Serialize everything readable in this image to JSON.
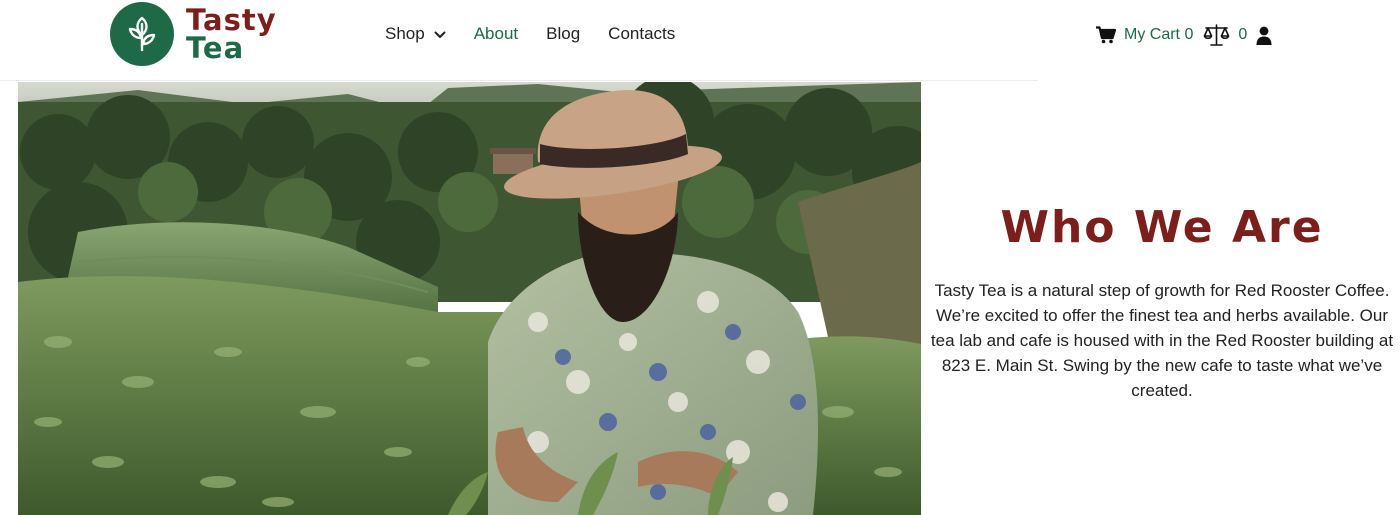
{
  "brand": {
    "line1": "Tasty",
    "line2": "Tea",
    "colors": {
      "red": "#7b1f1c",
      "green": "#1f6a46"
    }
  },
  "nav": {
    "items": [
      {
        "label": "Shop",
        "has_dropdown": true,
        "icon": "chevron-down-icon"
      },
      {
        "label": "About",
        "active": true
      },
      {
        "label": "Blog"
      },
      {
        "label": "Contacts"
      }
    ]
  },
  "utility": {
    "cart_label": "My Cart 0",
    "cart_icon": "cart-icon",
    "compare_icon": "scale-icon",
    "compare_count": "0",
    "account_icon": "user-icon"
  },
  "hero": {
    "image_subject": "man in straw hat and floral shirt picking tea leaves on a hillside tea plantation"
  },
  "about": {
    "title": "Who We Are",
    "body": "Tasty Tea is a natural step of growth for Red Rooster Coffee. We’re excited to offer the finest tea and herbs available. Our tea lab and cafe is housed with in the Red Rooster building at 823 E. Main St. Swing by the new cafe to taste what we’ve created."
  }
}
